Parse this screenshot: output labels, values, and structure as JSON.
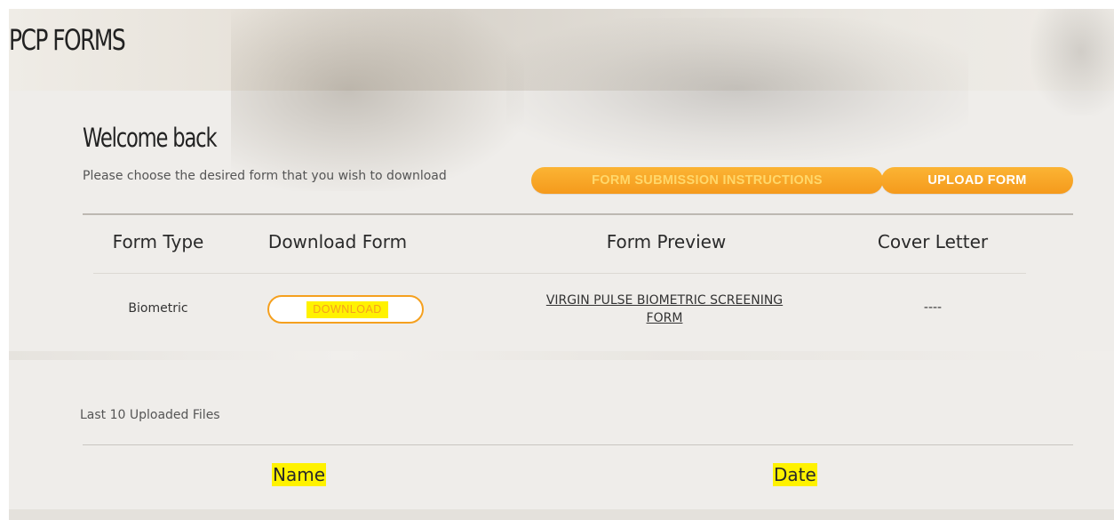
{
  "header": {
    "title": "PCP FORMS"
  },
  "welcome": {
    "heading": "Welcome back",
    "instruction": "Please choose the desired form that you wish to download"
  },
  "actions": {
    "instructions_label": "FORM SUBMISSION INSTRUCTIONS",
    "upload_label": "UPLOAD FORM"
  },
  "forms_table": {
    "columns": [
      "Form Type",
      "Download Form",
      "Form Preview",
      "Cover Letter"
    ],
    "rows": [
      {
        "form_type": "Biometric",
        "download_label": "DOWNLOAD",
        "preview_line1": "VIRGIN PULSE BIOMETRIC SCREENING",
        "preview_line2": "FORM",
        "cover_letter": "----"
      }
    ]
  },
  "uploads": {
    "label": "Last 10 Uploaded Files",
    "columns": [
      "Name",
      "Date"
    ]
  },
  "colors": {
    "accent_orange": "#f59a1c",
    "highlight_yellow": "#fff200",
    "background": "#efedea"
  }
}
